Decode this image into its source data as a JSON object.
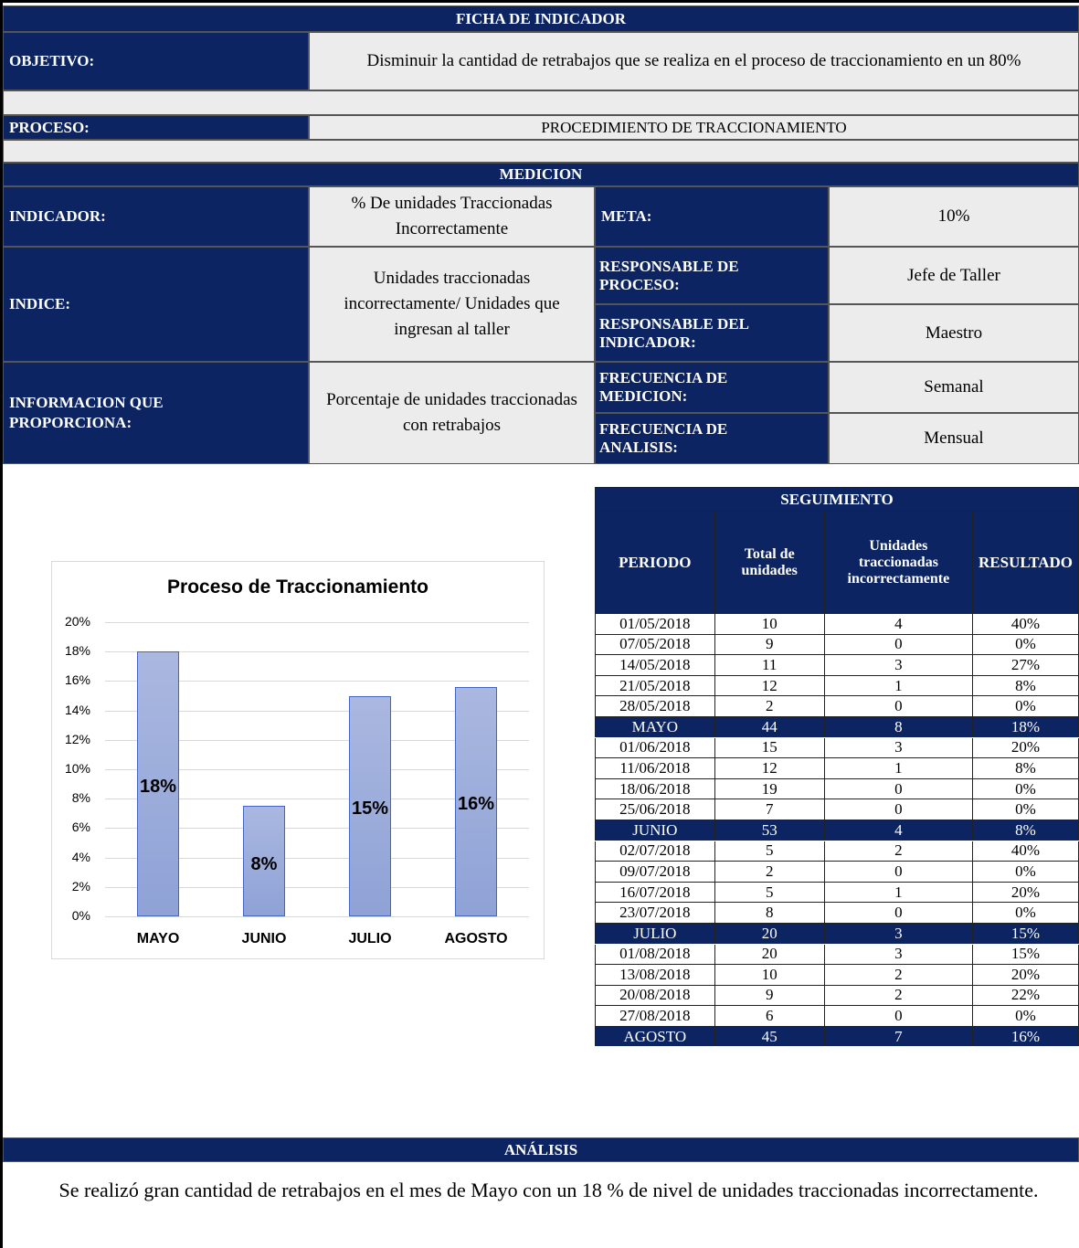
{
  "header": {
    "title": "FICHA DE INDICADOR",
    "objetivo_label": "OBJETIVO:",
    "objetivo_value": "Disminuir la cantidad de retrabajos que se realiza en el proceso de traccionamiento en un 80%",
    "proceso_label": "PROCESO:",
    "proceso_value": "PROCEDIMIENTO DE TRACCIONAMIENTO"
  },
  "medicion": {
    "title": "MEDICION",
    "indicador_label": "INDICADOR:",
    "indicador_value": "% De unidades Traccionadas Incorrectamente",
    "meta_label": "META:",
    "meta_value": "10%",
    "indice_label": "INDICE:",
    "indice_value": "Unidades traccionadas incorrectamente/ Unidades que ingresan al taller",
    "resp_proceso_label": "RESPONSABLE DE PROCESO:",
    "resp_proceso_value": "Jefe de Taller",
    "resp_indicador_label": "RESPONSABLE DEL INDICADOR:",
    "resp_indicador_value": "Maestro",
    "info_label": "INFORMACION QUE PROPORCIONA:",
    "info_value": "Porcentaje de unidades traccionadas con retrabajos",
    "frec_medicion_label": "FRECUENCIA DE MEDICION:",
    "frec_medicion_value": "Semanal",
    "frec_analisis_label": "FRECUENCIA DE ANALISIS:",
    "frec_analisis_value": "Mensual"
  },
  "seguimiento": {
    "title": "SEGUIMIENTO",
    "columns": [
      "PERIODO",
      "Total de unidades",
      "Unidades traccionadas incorrectamente",
      "RESULTADO"
    ],
    "rows": [
      {
        "periodo": "01/05/2018",
        "total": "10",
        "incorrectas": "4",
        "resultado": "40%",
        "summary": false
      },
      {
        "periodo": "07/05/2018",
        "total": "9",
        "incorrectas": "0",
        "resultado": "0%",
        "summary": false
      },
      {
        "periodo": "14/05/2018",
        "total": "11",
        "incorrectas": "3",
        "resultado": "27%",
        "summary": false
      },
      {
        "periodo": "21/05/2018",
        "total": "12",
        "incorrectas": "1",
        "resultado": "8%",
        "summary": false
      },
      {
        "periodo": "28/05/2018",
        "total": "2",
        "incorrectas": "0",
        "resultado": "0%",
        "summary": false
      },
      {
        "periodo": "MAYO",
        "total": "44",
        "incorrectas": "8",
        "resultado": "18%",
        "summary": true
      },
      {
        "periodo": "01/06/2018",
        "total": "15",
        "incorrectas": "3",
        "resultado": "20%",
        "summary": false
      },
      {
        "periodo": "11/06/2018",
        "total": "12",
        "incorrectas": "1",
        "resultado": "8%",
        "summary": false
      },
      {
        "periodo": "18/06/2018",
        "total": "19",
        "incorrectas": "0",
        "resultado": "0%",
        "summary": false
      },
      {
        "periodo": "25/06/2018",
        "total": "7",
        "incorrectas": "0",
        "resultado": "0%",
        "summary": false
      },
      {
        "periodo": "JUNIO",
        "total": "53",
        "incorrectas": "4",
        "resultado": "8%",
        "summary": true
      },
      {
        "periodo": "02/07/2018",
        "total": "5",
        "incorrectas": "2",
        "resultado": "40%",
        "summary": false
      },
      {
        "periodo": "09/07/2018",
        "total": "2",
        "incorrectas": "0",
        "resultado": "0%",
        "summary": false
      },
      {
        "periodo": "16/07/2018",
        "total": "5",
        "incorrectas": "1",
        "resultado": "20%",
        "summary": false
      },
      {
        "periodo": "23/07/2018",
        "total": "8",
        "incorrectas": "0",
        "resultado": "0%",
        "summary": false
      },
      {
        "periodo": "JULIO",
        "total": "20",
        "incorrectas": "3",
        "resultado": "15%",
        "summary": true
      },
      {
        "periodo": "01/08/2018",
        "total": "20",
        "incorrectas": "3",
        "resultado": "15%",
        "summary": false
      },
      {
        "periodo": "13/08/2018",
        "total": "10",
        "incorrectas": "2",
        "resultado": "20%",
        "summary": false
      },
      {
        "periodo": "20/08/2018",
        "total": "9",
        "incorrectas": "2",
        "resultado": "22%",
        "summary": false
      },
      {
        "periodo": "27/08/2018",
        "total": "6",
        "incorrectas": "0",
        "resultado": "0%",
        "summary": false
      },
      {
        "periodo": "AGOSTO",
        "total": "45",
        "incorrectas": "7",
        "resultado": "16%",
        "summary": true
      }
    ]
  },
  "analisis": {
    "title": "ANÁLISIS",
    "text": "Se realizó gran cantidad de retrabajos en el mes de Mayo con un 18 % de nivel de unidades traccionadas incorrectamente."
  },
  "colors": {
    "navy": "#0c2461",
    "bar_fill": "#8fa2d6",
    "bar_border": "#4466c2",
    "grey": "#ececec"
  },
  "chart_data": {
    "type": "bar",
    "title": "Proceso de Traccionamiento",
    "categories": [
      "MAYO",
      "JUNIO",
      "JULIO",
      "AGOSTO"
    ],
    "values": [
      18,
      7.5,
      15,
      15.6
    ],
    "data_labels": [
      "18%",
      "8%",
      "15%",
      "16%"
    ],
    "ylim": [
      0,
      20
    ],
    "yticks": [
      "0%",
      "2%",
      "4%",
      "6%",
      "8%",
      "10%",
      "12%",
      "14%",
      "16%",
      "18%",
      "20%"
    ],
    "grid": true,
    "legend": "none"
  }
}
